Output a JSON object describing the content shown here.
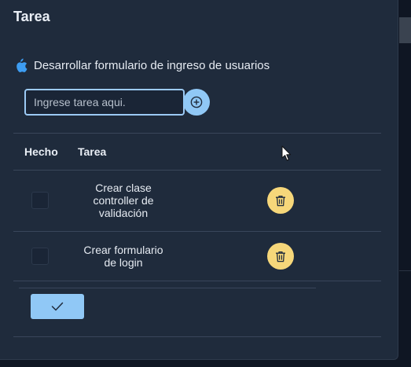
{
  "modal": {
    "title": "Tarea"
  },
  "task": {
    "icon": "apple-icon",
    "title": "Desarrollar formulario de ingreso de usuarios"
  },
  "new_task": {
    "placeholder": "Ingrese tarea aqui.",
    "value": "",
    "add_icon": "plus-circle-icon"
  },
  "table": {
    "headers": {
      "done": "Hecho",
      "task": "Tarea"
    },
    "rows": [
      {
        "done": false,
        "task": "Crear clase controller de validación",
        "action_icon": "trash-icon"
      },
      {
        "done": false,
        "task": "Crear formulario de login",
        "action_icon": "trash-icon"
      }
    ]
  },
  "footer": {
    "confirm_icon": "check-icon"
  },
  "colors": {
    "modal_bg": "#1f2b3c",
    "primary": "#90c8f6",
    "warning": "#f6d77a",
    "apple_icon": "#3d9df2"
  }
}
